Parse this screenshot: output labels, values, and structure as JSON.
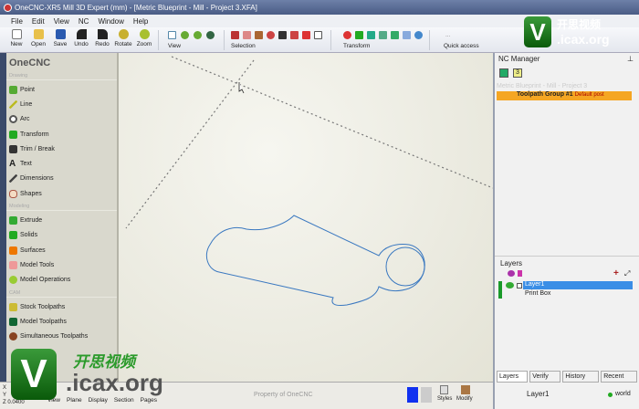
{
  "window": {
    "title": "OneCNC-XR5 Mill 3D Expert (mm) - [Metric Blueprint - Mill - Project 3.XFA]"
  },
  "menu": [
    "File",
    "Edit",
    "View",
    "NC",
    "Window",
    "Help"
  ],
  "toolbar": {
    "buttons": [
      "New",
      "Open",
      "Save",
      "Undo",
      "Redo",
      "Rotate",
      "Zoom"
    ],
    "groups": [
      "View",
      "Selection",
      "Transform",
      "Quick access"
    ],
    "quick_dots": "..."
  },
  "left": {
    "title": "OneCNC",
    "sections": [
      {
        "label": "Drawing",
        "items": [
          "Point",
          "Line",
          "Arc",
          "Transform",
          "Trim / Break",
          "Text",
          "Dimensions",
          "Shapes"
        ]
      },
      {
        "label": "Modeling",
        "items": [
          "Extrude",
          "Solids",
          "Surfaces",
          "Model Tools",
          "Model Operations"
        ]
      },
      {
        "label": "CAM",
        "items": [
          "Stock Toolpaths",
          "Model Toolpaths",
          "Simultaneous Toolpaths"
        ]
      }
    ]
  },
  "nc": {
    "title": "NC Manager",
    "project": "Metric Blueprint - Mill - Project 3",
    "group": "Toolpath Group #1",
    "post": "Default post",
    "badge": "3"
  },
  "layers": {
    "title": "Layers",
    "rows": [
      "Layer1",
      "Print Box"
    ],
    "tabs": [
      "Layers",
      "Verify",
      "History",
      "Recent"
    ],
    "current": "Layer1",
    "world": "world"
  },
  "status": {
    "axes": [
      "X",
      "Y",
      "Z"
    ],
    "z_value": "0.0400",
    "buttons": [
      "View",
      "Plane",
      "Display",
      "Section",
      "Pages"
    ],
    "property": "Property of OneCNC",
    "right_buttons": [
      "Styles",
      "Modify"
    ]
  },
  "watermark": {
    "cn": "开思视频",
    "url": ".icax.org",
    "letter": "V"
  },
  "colors": {
    "accent": "#f5a623",
    "select": "#3a8ee6",
    "part": "#3a78c0"
  }
}
